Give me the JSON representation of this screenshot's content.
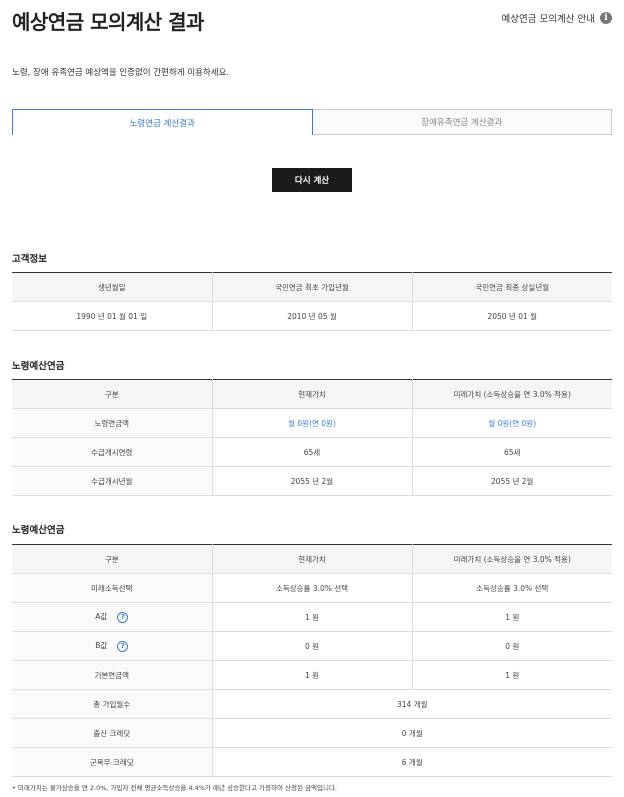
{
  "header": {
    "title": "예상연금 모의계산 결과",
    "guide_label": "예상연금 모의계산 안내",
    "guide_icon": "info-icon"
  },
  "description": "노령, 장애 유족연금 예상액을 인증없이 간편하게 이용하세요.",
  "tabs": [
    {
      "label": "노령연금 계산결과",
      "active": true
    },
    {
      "label": "장애유족연금 계산결과",
      "active": false
    }
  ],
  "recalc_button": "다시 계산",
  "customer": {
    "title": "고객정보",
    "headers": [
      "생년월일",
      "국민연금 최초 가입년월",
      "국민연금 최종 상실년월"
    ],
    "row": [
      "1990 년 01 월 01 일",
      "2010 년 05 월",
      "2050 년 01 월"
    ]
  },
  "estimate1": {
    "title": "노령예산연금",
    "headers": [
      "구분",
      "현재가치",
      "미래가치 (소득상승을 연 3.0% 적용)"
    ],
    "rows": [
      [
        "노령연금액",
        "월 0원(연 0원)",
        "월 0원(연 0원)"
      ],
      [
        "수급개시연령",
        "65세",
        "65세"
      ],
      [
        "수급개시년월",
        "2055 년 2월",
        "2055 년 2월"
      ]
    ]
  },
  "estimate2": {
    "title": "노령예산연금",
    "headers": [
      "구분",
      "현재가치",
      "미래가치 (소득상승을 연 3.0% 적용)"
    ],
    "rows": [
      [
        "미래소득선택",
        "소득상승률 3.0% 선택",
        "소득상승률 3.0% 선택"
      ],
      [
        "A값",
        "1 원",
        "1 원"
      ],
      [
        "B값",
        "0 원",
        "0 원"
      ],
      [
        "기본연금액",
        "1 원",
        "1 원"
      ]
    ],
    "merged_rows": [
      [
        "총 가입월수",
        "314 개월"
      ],
      [
        "출산 크레딧",
        "0 개월"
      ],
      [
        "군복무 크레딧",
        "6 개월"
      ]
    ],
    "help_icon": "question-icon"
  },
  "footnote": "• 미래가치는 물가상승을 연 2.0%, 가입자 전체 평균소득상승을 4.4%가 매년 상승한다고 가정하여 산정된 금액입니다.",
  "colors": {
    "accent": "#3a7bd5",
    "button": "#1b1b1b"
  }
}
